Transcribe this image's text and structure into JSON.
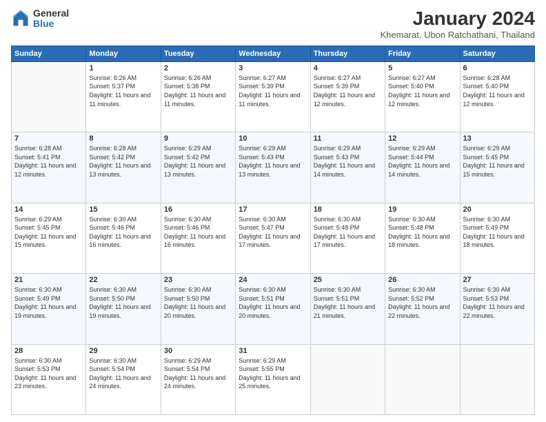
{
  "header": {
    "logo_general": "General",
    "logo_blue": "Blue",
    "title": "January 2024",
    "subtitle": "Khemarat, Ubon Ratchathani, Thailand"
  },
  "columns": [
    "Sunday",
    "Monday",
    "Tuesday",
    "Wednesday",
    "Thursday",
    "Friday",
    "Saturday"
  ],
  "weeks": [
    [
      {
        "day": "",
        "sunrise": "",
        "sunset": "",
        "daylight": ""
      },
      {
        "day": "1",
        "sunrise": "Sunrise: 6:26 AM",
        "sunset": "Sunset: 5:37 PM",
        "daylight": "Daylight: 11 hours and 11 minutes."
      },
      {
        "day": "2",
        "sunrise": "Sunrise: 6:26 AM",
        "sunset": "Sunset: 5:38 PM",
        "daylight": "Daylight: 11 hours and 11 minutes."
      },
      {
        "day": "3",
        "sunrise": "Sunrise: 6:27 AM",
        "sunset": "Sunset: 5:39 PM",
        "daylight": "Daylight: 11 hours and 11 minutes."
      },
      {
        "day": "4",
        "sunrise": "Sunrise: 6:27 AM",
        "sunset": "Sunset: 5:39 PM",
        "daylight": "Daylight: 11 hours and 12 minutes."
      },
      {
        "day": "5",
        "sunrise": "Sunrise: 6:27 AM",
        "sunset": "Sunset: 5:40 PM",
        "daylight": "Daylight: 11 hours and 12 minutes."
      },
      {
        "day": "6",
        "sunrise": "Sunrise: 6:28 AM",
        "sunset": "Sunset: 5:40 PM",
        "daylight": "Daylight: 11 hours and 12 minutes."
      }
    ],
    [
      {
        "day": "7",
        "sunrise": "Sunrise: 6:28 AM",
        "sunset": "Sunset: 5:41 PM",
        "daylight": "Daylight: 11 hours and 12 minutes."
      },
      {
        "day": "8",
        "sunrise": "Sunrise: 6:28 AM",
        "sunset": "Sunset: 5:42 PM",
        "daylight": "Daylight: 11 hours and 13 minutes."
      },
      {
        "day": "9",
        "sunrise": "Sunrise: 6:29 AM",
        "sunset": "Sunset: 5:42 PM",
        "daylight": "Daylight: 11 hours and 13 minutes."
      },
      {
        "day": "10",
        "sunrise": "Sunrise: 6:29 AM",
        "sunset": "Sunset: 5:43 PM",
        "daylight": "Daylight: 11 hours and 13 minutes."
      },
      {
        "day": "11",
        "sunrise": "Sunrise: 6:29 AM",
        "sunset": "Sunset: 5:43 PM",
        "daylight": "Daylight: 11 hours and 14 minutes."
      },
      {
        "day": "12",
        "sunrise": "Sunrise: 6:29 AM",
        "sunset": "Sunset: 5:44 PM",
        "daylight": "Daylight: 11 hours and 14 minutes."
      },
      {
        "day": "13",
        "sunrise": "Sunrise: 6:29 AM",
        "sunset": "Sunset: 5:45 PM",
        "daylight": "Daylight: 11 hours and 15 minutes."
      }
    ],
    [
      {
        "day": "14",
        "sunrise": "Sunrise: 6:29 AM",
        "sunset": "Sunset: 5:45 PM",
        "daylight": "Daylight: 11 hours and 15 minutes."
      },
      {
        "day": "15",
        "sunrise": "Sunrise: 6:30 AM",
        "sunset": "Sunset: 5:46 PM",
        "daylight": "Daylight: 11 hours and 16 minutes."
      },
      {
        "day": "16",
        "sunrise": "Sunrise: 6:30 AM",
        "sunset": "Sunset: 5:46 PM",
        "daylight": "Daylight: 11 hours and 16 minutes."
      },
      {
        "day": "17",
        "sunrise": "Sunrise: 6:30 AM",
        "sunset": "Sunset: 5:47 PM",
        "daylight": "Daylight: 11 hours and 17 minutes."
      },
      {
        "day": "18",
        "sunrise": "Sunrise: 6:30 AM",
        "sunset": "Sunset: 5:48 PM",
        "daylight": "Daylight: 11 hours and 17 minutes."
      },
      {
        "day": "19",
        "sunrise": "Sunrise: 6:30 AM",
        "sunset": "Sunset: 5:48 PM",
        "daylight": "Daylight: 11 hours and 18 minutes."
      },
      {
        "day": "20",
        "sunrise": "Sunrise: 6:30 AM",
        "sunset": "Sunset: 5:49 PM",
        "daylight": "Daylight: 11 hours and 18 minutes."
      }
    ],
    [
      {
        "day": "21",
        "sunrise": "Sunrise: 6:30 AM",
        "sunset": "Sunset: 5:49 PM",
        "daylight": "Daylight: 11 hours and 19 minutes."
      },
      {
        "day": "22",
        "sunrise": "Sunrise: 6:30 AM",
        "sunset": "Sunset: 5:50 PM",
        "daylight": "Daylight: 11 hours and 19 minutes."
      },
      {
        "day": "23",
        "sunrise": "Sunrise: 6:30 AM",
        "sunset": "Sunset: 5:50 PM",
        "daylight": "Daylight: 11 hours and 20 minutes."
      },
      {
        "day": "24",
        "sunrise": "Sunrise: 6:30 AM",
        "sunset": "Sunset: 5:51 PM",
        "daylight": "Daylight: 11 hours and 20 minutes."
      },
      {
        "day": "25",
        "sunrise": "Sunrise: 6:30 AM",
        "sunset": "Sunset: 5:51 PM",
        "daylight": "Daylight: 11 hours and 21 minutes."
      },
      {
        "day": "26",
        "sunrise": "Sunrise: 6:30 AM",
        "sunset": "Sunset: 5:52 PM",
        "daylight": "Daylight: 11 hours and 22 minutes."
      },
      {
        "day": "27",
        "sunrise": "Sunrise: 6:30 AM",
        "sunset": "Sunset: 5:53 PM",
        "daylight": "Daylight: 11 hours and 22 minutes."
      }
    ],
    [
      {
        "day": "28",
        "sunrise": "Sunrise: 6:30 AM",
        "sunset": "Sunset: 5:53 PM",
        "daylight": "Daylight: 11 hours and 23 minutes."
      },
      {
        "day": "29",
        "sunrise": "Sunrise: 6:30 AM",
        "sunset": "Sunset: 5:54 PM",
        "daylight": "Daylight: 11 hours and 24 minutes."
      },
      {
        "day": "30",
        "sunrise": "Sunrise: 6:29 AM",
        "sunset": "Sunset: 5:54 PM",
        "daylight": "Daylight: 11 hours and 24 minutes."
      },
      {
        "day": "31",
        "sunrise": "Sunrise: 6:29 AM",
        "sunset": "Sunset: 5:55 PM",
        "daylight": "Daylight: 11 hours and 25 minutes."
      },
      {
        "day": "",
        "sunrise": "",
        "sunset": "",
        "daylight": ""
      },
      {
        "day": "",
        "sunrise": "",
        "sunset": "",
        "daylight": ""
      },
      {
        "day": "",
        "sunrise": "",
        "sunset": "",
        "daylight": ""
      }
    ]
  ]
}
